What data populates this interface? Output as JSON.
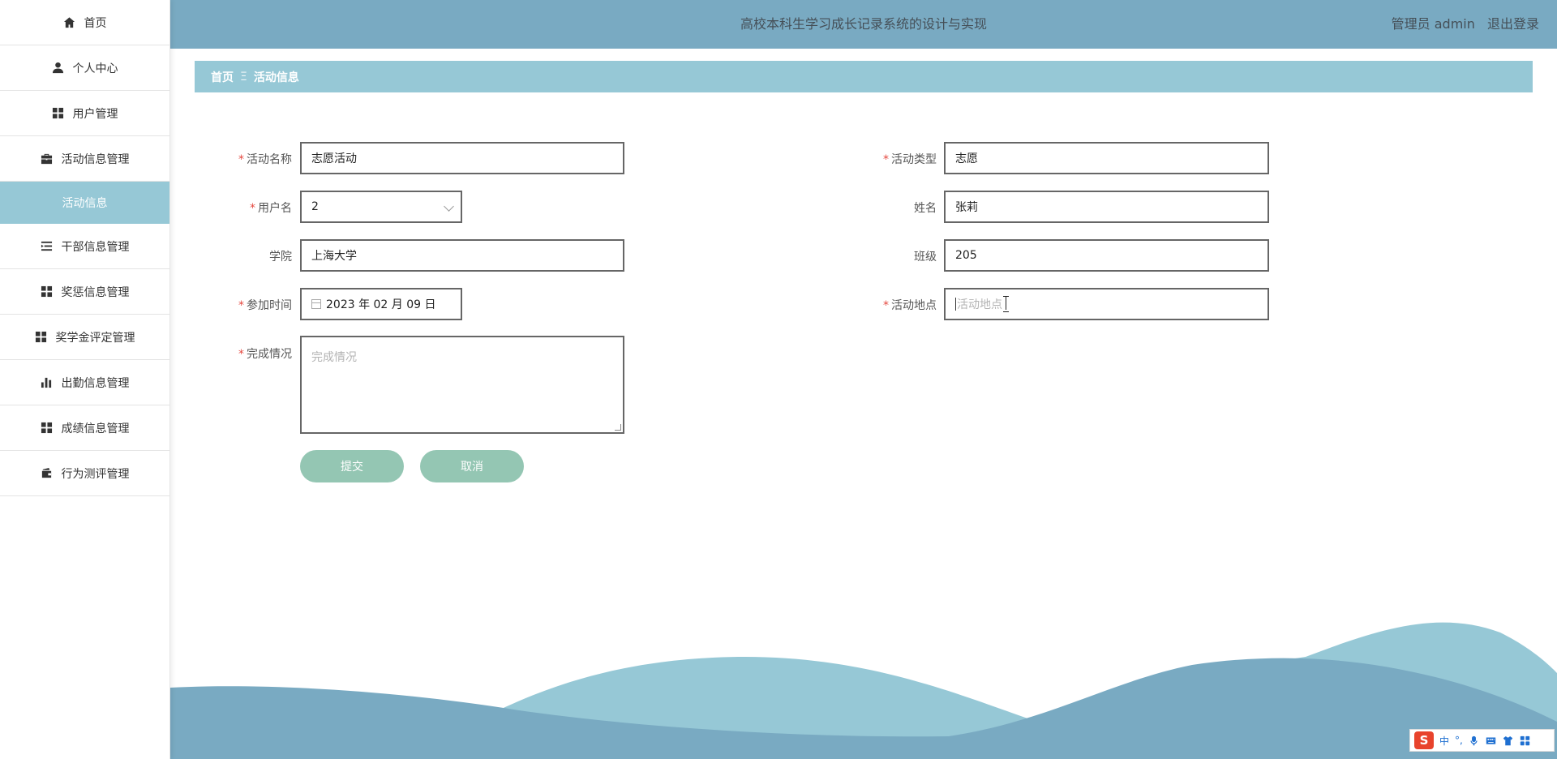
{
  "header": {
    "title": "高校本科生学习成长记录系统的设计与实现",
    "user": "管理员 admin",
    "logout": "退出登录"
  },
  "sidebar": {
    "items": [
      {
        "label": "首页",
        "icon": "home-icon"
      },
      {
        "label": "个人中心",
        "icon": "user-icon"
      },
      {
        "label": "用户管理",
        "icon": "grid-icon"
      },
      {
        "label": "活动信息管理",
        "icon": "briefcase-icon"
      },
      {
        "label": "活动信息",
        "icon": ""
      },
      {
        "label": "干部信息管理",
        "icon": "list-indent-icon"
      },
      {
        "label": "奖惩信息管理",
        "icon": "grid-icon"
      },
      {
        "label": "奖学金评定管理",
        "icon": "grid-icon"
      },
      {
        "label": "出勤信息管理",
        "icon": "bar-chart-icon"
      },
      {
        "label": "成绩信息管理",
        "icon": "grid-icon"
      },
      {
        "label": "行为测评管理",
        "icon": "wallet-icon"
      }
    ],
    "active_index": 4
  },
  "breadcrumb": {
    "home": "首页",
    "separator": "Ξ",
    "current": "活动信息"
  },
  "form": {
    "activity_name": {
      "label": "活动名称",
      "value": "志愿活动",
      "required": true
    },
    "activity_type": {
      "label": "活动类型",
      "value": "志愿",
      "required": true
    },
    "username": {
      "label": "用户名",
      "value": "2",
      "required": true
    },
    "name": {
      "label": "姓名",
      "value": "张莉",
      "required": false
    },
    "college": {
      "label": "学院",
      "value": "上海大学",
      "required": false
    },
    "class": {
      "label": "班级",
      "value": "205",
      "required": false
    },
    "join_time": {
      "label": "参加时间",
      "value": "2023 年 02 月 09 日",
      "required": true
    },
    "location": {
      "label": "活动地点",
      "value": "",
      "placeholder": "活动地点",
      "required": true
    },
    "completion": {
      "label": "完成情况",
      "value": "",
      "placeholder": "完成情况",
      "required": true
    },
    "required_mark": "*"
  },
  "actions": {
    "submit": "提交",
    "cancel": "取消"
  },
  "ime_toolbar": {
    "logo": "S",
    "mode": "中",
    "punct": "°,"
  },
  "colors": {
    "header_bg": "#79aac2",
    "accent": "#96c8d6",
    "button": "#94c6b3",
    "required": "#e5483f"
  }
}
